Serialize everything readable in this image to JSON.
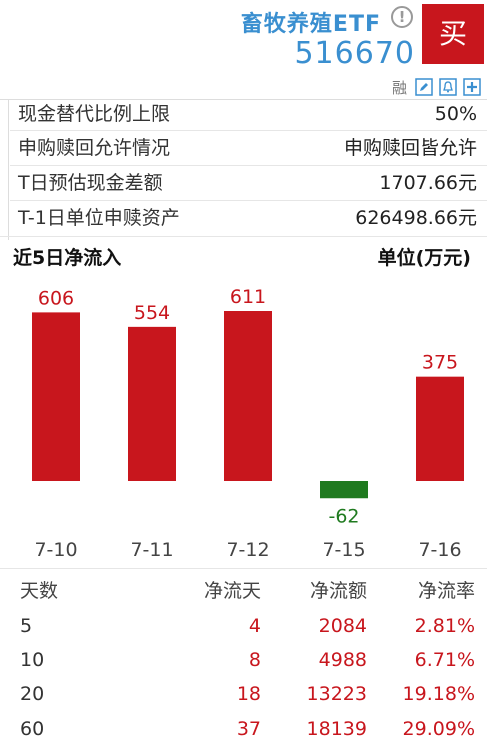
{
  "header": {
    "name": "畜牧养殖ETF",
    "code": "516670",
    "buy_label": "买",
    "rong_label": "融",
    "info_glyph": "!",
    "tool_icons": [
      "pencil-icon",
      "bell-icon",
      "plus-icon"
    ]
  },
  "info": {
    "rows": [
      {
        "label": "现金替代比例上限",
        "value": "50%"
      },
      {
        "label": "申购赎回允许情况",
        "value": "申购赎回皆允许"
      },
      {
        "label": "T日预估现金差额",
        "value": "1707.66元"
      },
      {
        "label": "T-1日单位申赎资产",
        "value": "626498.66元"
      }
    ]
  },
  "flow": {
    "title": "近5日净流入",
    "unit": "单位(万元)"
  },
  "chart_data": {
    "type": "bar",
    "categories": [
      "7-10",
      "7-11",
      "7-12",
      "7-15",
      "7-16"
    ],
    "values": [
      606,
      554,
      611,
      -62,
      375
    ],
    "title": "近5日净流入",
    "ylabel": "单位(万元)",
    "positive_color": "#c8161d",
    "negative_color": "#1f7a1f"
  },
  "table": {
    "headers": [
      "天数",
      "净流天",
      "净流额",
      "净流率"
    ],
    "rows": [
      [
        "5",
        "4",
        "2084",
        "2.81%"
      ],
      [
        "10",
        "8",
        "4988",
        "6.71%"
      ],
      [
        "20",
        "18",
        "13223",
        "19.18%"
      ],
      [
        "60",
        "37",
        "18139",
        "29.09%"
      ]
    ]
  }
}
